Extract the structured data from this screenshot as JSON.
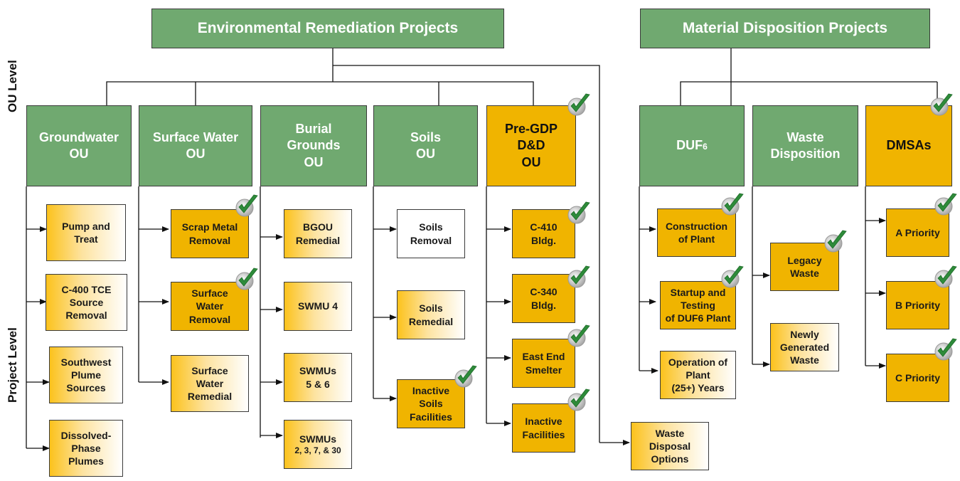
{
  "side_labels": {
    "ou_level": "OU Level",
    "project_level": "Project Level"
  },
  "top": {
    "env": "Environmental Remediation Projects",
    "mat": "Material Disposition Projects"
  },
  "ou": {
    "groundwater": "Groundwater\nOU",
    "surface_water": "Surface Water\nOU",
    "burial": "Burial\nGrounds\nOU",
    "soils": "Soils\nOU",
    "pregdp": "Pre-GDP\nD&D\nOU",
    "duf6": "DUF",
    "duf6_sub": "6",
    "waste_disp": "Waste\nDisposition",
    "dmsas": "DMSAs"
  },
  "projects": {
    "pump_treat": "Pump and\nTreat",
    "c400": "C-400 TCE\nSource\nRemoval",
    "southwest": "Southwest\nPlume\nSources",
    "dissolved": "Dissolved-\nPhase\nPlumes",
    "scrap_metal": "Scrap Metal\nRemoval",
    "sw_removal": "Surface\nWater\nRemoval",
    "sw_remedial": "Surface\nWater\nRemedial",
    "bgou_remedial": "BGOU\nRemedial",
    "swmu4": "SWMU  4",
    "swmu56": "SWMUs\n5 & 6",
    "swmu_multi_title": "SWMUs",
    "swmu_multi_sub": "2, 3, 7, & 30",
    "soils_removal": "Soils\nRemoval",
    "soils_remedial": "Soils\nRemedial",
    "inactive_soils": "Inactive\nSoils\nFacilities",
    "c410": "C-410\nBldg.",
    "c340": "C-340\nBldg.",
    "east_end": "East End\nSmelter",
    "inactive_fac": "Inactive\nFacilities",
    "waste_disposal_options": "Waste\nDisposal\nOptions",
    "construction": "Construction\nof Plant",
    "startup": "Startup and\nTesting\nof DUF6 Plant",
    "operation": "Operation of\nPlant\n(25+) Years",
    "legacy": "Legacy\nWaste",
    "newly": "Newly\nGenerated\nWaste",
    "a_priority": "A Priority",
    "b_priority": "B Priority",
    "c_priority": "C Priority"
  },
  "colors": {
    "green": "#70a970",
    "complete": "#f0b400",
    "gradient_start": "#fcc21c",
    "check": "#2e8b3a"
  },
  "completed_items": [
    "pregdp",
    "dmsas",
    "scrap_metal",
    "sw_removal",
    "inactive_soils",
    "c410",
    "c340",
    "east_end",
    "inactive_fac",
    "construction",
    "startup",
    "legacy",
    "a_priority",
    "b_priority",
    "c_priority"
  ]
}
